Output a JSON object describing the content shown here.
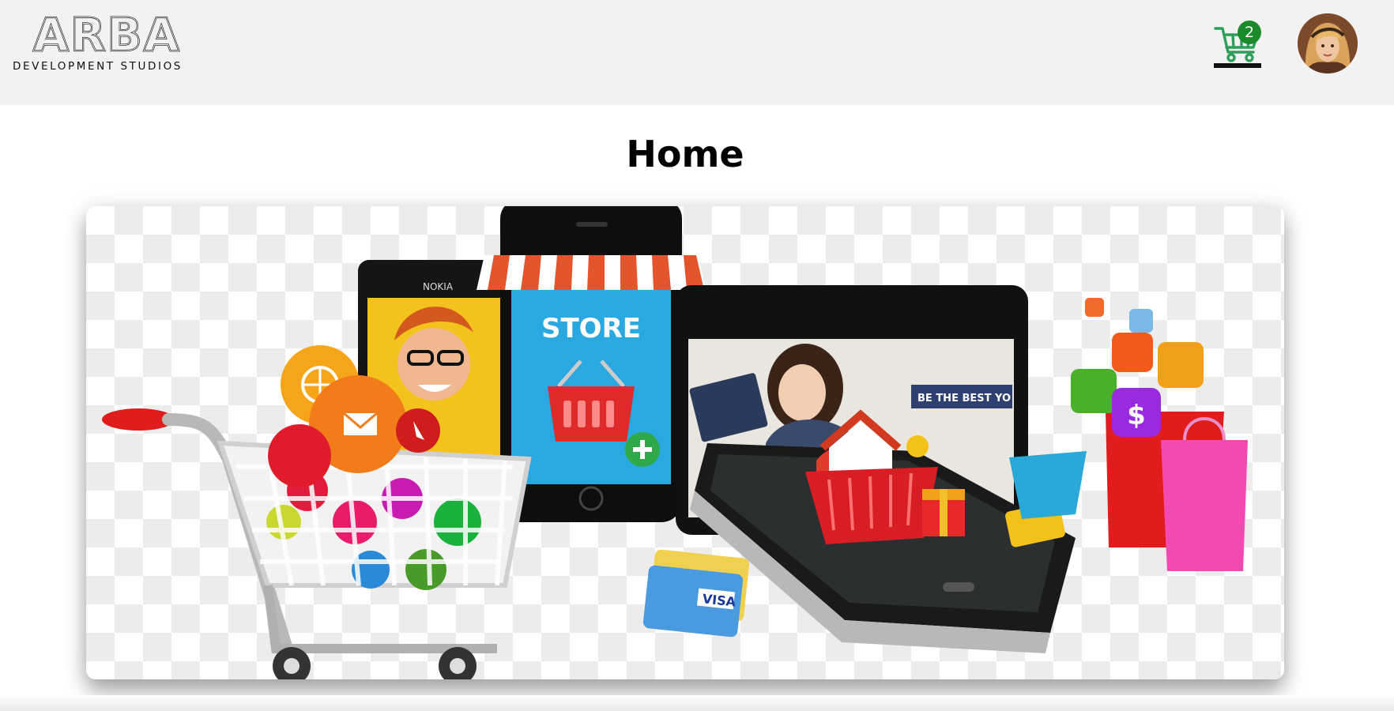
{
  "header": {
    "logo_text": "ARBA",
    "logo_subtitle": "DEVELOPMENT STUDIOS",
    "cart_count": "2",
    "cart_icon": "shopping-cart-icon",
    "avatar_icon": "user-avatar"
  },
  "main": {
    "title": "Home",
    "banner": {
      "store_label": "STORE",
      "phone_brand": "NOKIA",
      "tablet_tagline": "BE THE BEST YO",
      "card_brand": "VISA",
      "price_symbol": "$"
    }
  },
  "colors": {
    "header_bg": "#f2f2f2",
    "badge": "#1a8a2b",
    "cart_green": "#2e9f5a",
    "store_blue": "#2aa8e0"
  }
}
